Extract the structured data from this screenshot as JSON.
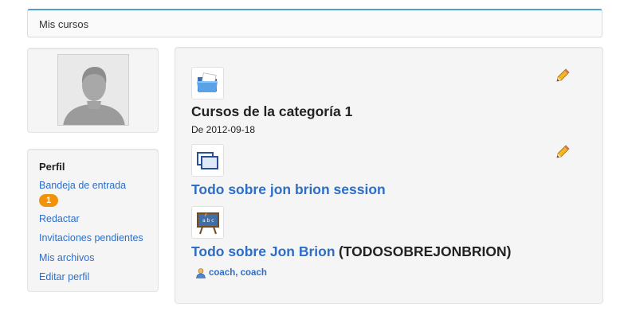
{
  "breadcrumb": {
    "label": "Mis cursos"
  },
  "profile": {
    "title": "Perfil",
    "links": [
      {
        "label": "Bandeja de entrada",
        "badge": "1"
      },
      {
        "label": "Redactar"
      },
      {
        "label": "Invitaciones pendientes"
      },
      {
        "label": "Mis archivos"
      },
      {
        "label": "Editar perfil"
      }
    ]
  },
  "category": {
    "title": "Cursos de la categoría 1",
    "date": "De 2012-09-18",
    "icon": "folder-icon"
  },
  "courses": [
    {
      "title": "Todo sobre jon brion session",
      "icon": "session-icon"
    },
    {
      "title": "Todo sobre Jon Brion",
      "code": "(TODOSOBREJONBRION)",
      "coaches": "coach, coach",
      "icon": "blackboard-icon"
    }
  ],
  "colors": {
    "link": "#2d6ec9",
    "badge": "#f0930a",
    "top_border": "#4f9fd6"
  }
}
